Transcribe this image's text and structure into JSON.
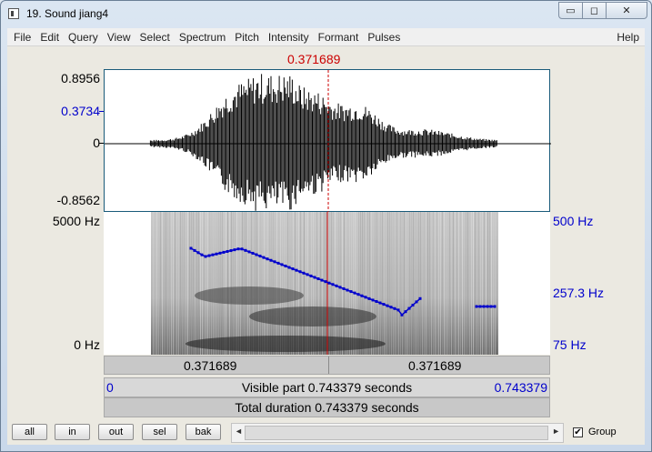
{
  "window": {
    "title": "19. Sound jiang4",
    "min_glyph": "▭",
    "max_glyph": "◻",
    "close_glyph": "✕"
  },
  "menu": [
    "File",
    "Edit",
    "Query",
    "View",
    "Select",
    "Spectrum",
    "Pitch",
    "Intensity",
    "Formant",
    "Pulses"
  ],
  "menu_help": "Help",
  "cursor_time": "0.371689",
  "waveform": {
    "max_label": "0.8956",
    "cursor_value_label": "0.3734",
    "zero_label": "0",
    "min_label": "-0.8562"
  },
  "spectrogram": {
    "top_label": "5000 Hz",
    "bottom_label": "0 Hz"
  },
  "pitch": {
    "top_label": "500 Hz",
    "mid_label": "257.3 Hz",
    "bottom_label": "75 Hz",
    "color": "#0000cc"
  },
  "segments": {
    "left_time": "0.371689",
    "right_time": "0.371689"
  },
  "visible": {
    "start": "0",
    "text": "Visible part 0.743379 seconds",
    "end": "0.743379"
  },
  "total": {
    "text": "Total duration 0.743379 seconds"
  },
  "buttons": {
    "all": "all",
    "in": "in",
    "out": "out",
    "sel": "sel",
    "bak": "bak"
  },
  "scroll": {
    "left": "◄",
    "right": "►"
  },
  "group": {
    "label": "Group",
    "checked": "✔"
  }
}
